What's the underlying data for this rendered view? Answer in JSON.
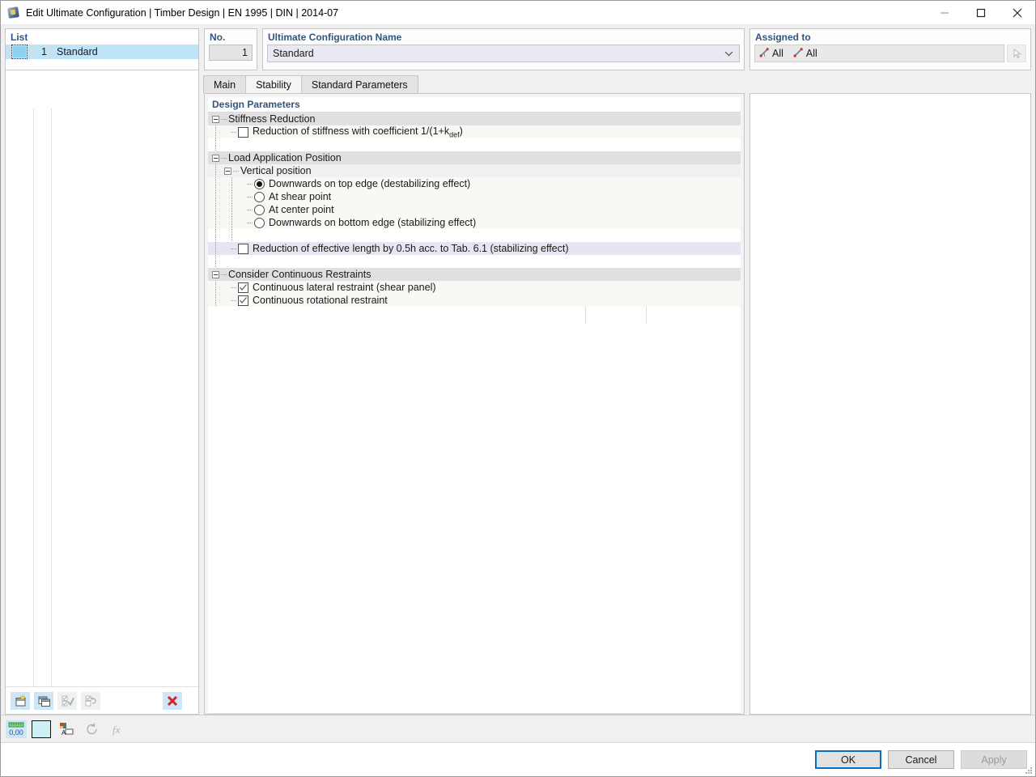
{
  "window": {
    "title": "Edit Ultimate Configuration | Timber Design | EN 1995 | DIN | 2014-07",
    "icon": "app-cube-icon",
    "minimize": "minimize-icon",
    "maximize": "maximize-icon",
    "close": "close-icon"
  },
  "list_panel": {
    "header": "List",
    "rows": [
      {
        "no": "1",
        "name": "Standard",
        "selected": true
      }
    ],
    "toolbar": [
      {
        "name": "new-configuration-button",
        "icon": "new-window-icon",
        "enabled": true
      },
      {
        "name": "duplicate-configuration-button",
        "icon": "copy-window-icon",
        "enabled": true
      },
      {
        "name": "select-all-button",
        "icon": "check-all-icon",
        "enabled": false
      },
      {
        "name": "invert-selection-button",
        "icon": "toggle-check-icon",
        "enabled": false
      },
      {
        "name": "delete-configuration-button",
        "icon": "red-x-icon",
        "enabled": true
      }
    ]
  },
  "number_panel": {
    "label": "No.",
    "value": "1"
  },
  "name_panel": {
    "label": "Ultimate Configuration Name",
    "value": "Standard",
    "dropdown_icon": "chevron-down-icon"
  },
  "assigned_panel": {
    "label": "Assigned to",
    "items": [
      {
        "icon": "member-set-icon",
        "label": "All"
      },
      {
        "icon": "member-icon",
        "label": "All"
      }
    ],
    "pick_button_icon": "pick-in-graphic-icon"
  },
  "tabs": [
    {
      "label": "Main",
      "active": false
    },
    {
      "label": "Stability",
      "active": true
    },
    {
      "label": "Standard Parameters",
      "active": false
    }
  ],
  "design_parameters": {
    "section_title": "Design Parameters",
    "groups": [
      {
        "title": "Stiffness Reduction",
        "rows": [
          {
            "type": "checkbox",
            "checked": false,
            "label_pre": "Reduction of stiffness with coefficient 1/(1+k",
            "label_sub": "def",
            "label_post": ")"
          }
        ]
      },
      {
        "title": "Load Application Position",
        "subgroup": "Vertical position",
        "rows": [
          {
            "type": "radio",
            "checked": true,
            "label": "Downwards on top edge (destabilizing effect)"
          },
          {
            "type": "radio",
            "checked": false,
            "label": "At shear point"
          },
          {
            "type": "radio",
            "checked": false,
            "label": "At center point"
          },
          {
            "type": "radio",
            "checked": false,
            "label": "Downwards on bottom edge (stabilizing effect)"
          }
        ],
        "extra_rows": [
          {
            "type": "checkbox",
            "checked": false,
            "highlighted": true,
            "label": "Reduction of effective length by 0.5h acc. to Tab. 6.1 (stabilizing effect)"
          }
        ]
      },
      {
        "title": "Consider Continuous Restraints",
        "rows": [
          {
            "type": "checkbox",
            "checked": true,
            "label": "Continuous lateral restraint (shear panel)"
          },
          {
            "type": "checkbox",
            "checked": true,
            "label": "Continuous rotational restraint"
          }
        ]
      }
    ]
  },
  "statusbar": {
    "buttons": [
      {
        "name": "decimal-places-button",
        "icon": "ruler-decimal-icon",
        "value": "0,00"
      },
      {
        "name": "color-swatch-button",
        "icon": "color-swatch-icon",
        "color": "#cdf0f5"
      },
      {
        "name": "display-properties-button",
        "icon": "color-palette-icon"
      },
      {
        "name": "reset-defaults-button",
        "icon": "undo-circle-icon",
        "enabled": false
      },
      {
        "name": "formula-button",
        "icon": "fx-icon",
        "enabled": false
      }
    ]
  },
  "footer": {
    "ok": "OK",
    "cancel": "Cancel",
    "apply": "Apply"
  },
  "colors": {
    "accent": "#31547d",
    "focus_blue": "#0c6cc0",
    "selection": "#bfe3f7",
    "row_item": "#f8f9f4",
    "row_group": "#e0e0e0",
    "row_highlight": "#e6e6f2"
  }
}
